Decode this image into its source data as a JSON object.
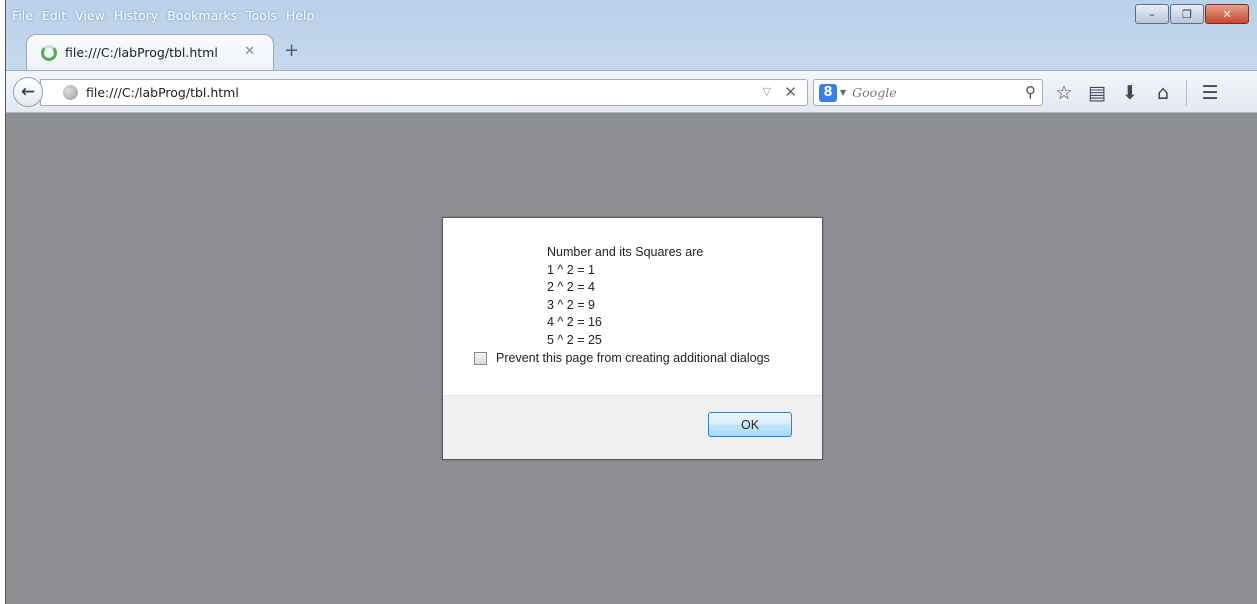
{
  "menu": [
    "File",
    "Edit",
    "View",
    "History",
    "Bookmarks",
    "Tools",
    "Help"
  ],
  "window_controls": {
    "minimize": "–",
    "maximize": "❐",
    "close": "✕"
  },
  "tab": {
    "title": "file:///C:/labProg/tbl.html",
    "close": "✕",
    "new_tab": "+"
  },
  "navbar": {
    "back": "←",
    "url": "file:///C:/labProg/tbl.html",
    "url_dropdown": "▽",
    "url_clear": "✕",
    "search_engine_logo": "8",
    "search_engine_caret": "▼",
    "search_placeholder": "Google",
    "search_icon": "⚲",
    "icons": {
      "bookmark": "☆",
      "reading_list": "▤",
      "download": "⬇",
      "home": "⌂",
      "menu": "☰"
    }
  },
  "dialog": {
    "heading": "Number and its Squares are",
    "lines": [
      "1 ^ 2 = 1",
      "2 ^ 2 = 4",
      "3 ^ 2 = 9",
      "4 ^ 2 = 16",
      "5 ^ 2 = 25"
    ],
    "checkbox_label": "Prevent this page from creating additional dialogs",
    "checkbox_checked": false,
    "ok_label": "OK"
  }
}
